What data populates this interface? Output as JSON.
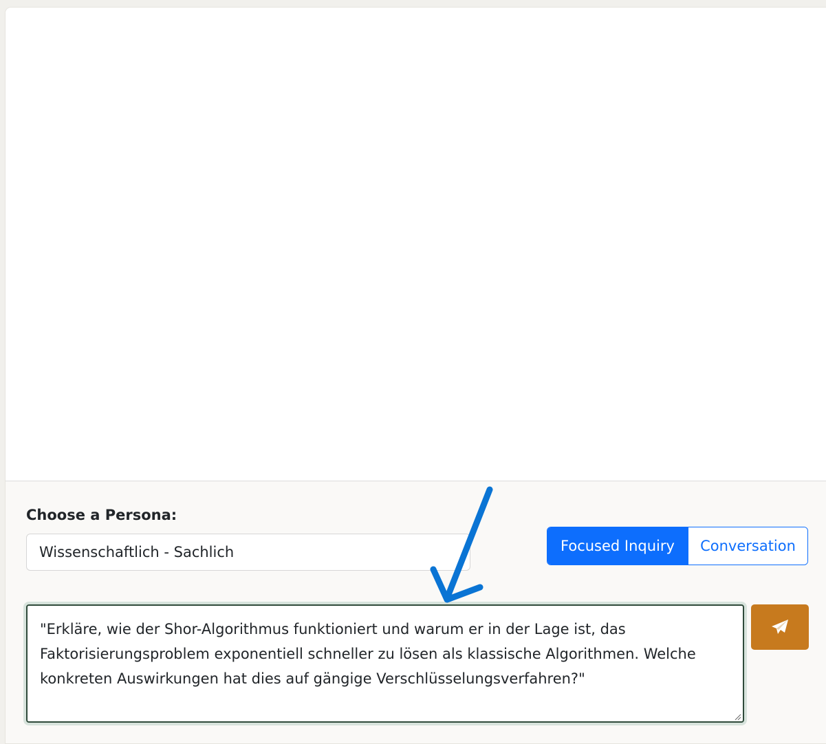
{
  "persona": {
    "label": "Choose a Persona:",
    "selected": "Wissenschaftlich - Sachlich"
  },
  "mode_toggle": {
    "options": [
      "Focused Inquiry",
      "Conversation"
    ],
    "active": "Focused Inquiry"
  },
  "prompt": {
    "value": "\"Erkläre, wie der Shor-Algorithmus funktioniert und warum er in der Lage ist, das Faktorisierungsproblem exponentiell schneller zu lösen als klassische Algorithmen. Welche konkreten Auswirkungen hat dies auf gängige Verschlüsselungsverfahren?\""
  },
  "send_button": {
    "icon": "paper-plane-icon",
    "color": "#c77a1e"
  },
  "annotation": {
    "icon": "arrow-down-annotation",
    "color": "#0a74d4"
  },
  "colors": {
    "primary": "#0d6efd",
    "send": "#c77a1e",
    "page_bg": "#f1f0ec"
  }
}
